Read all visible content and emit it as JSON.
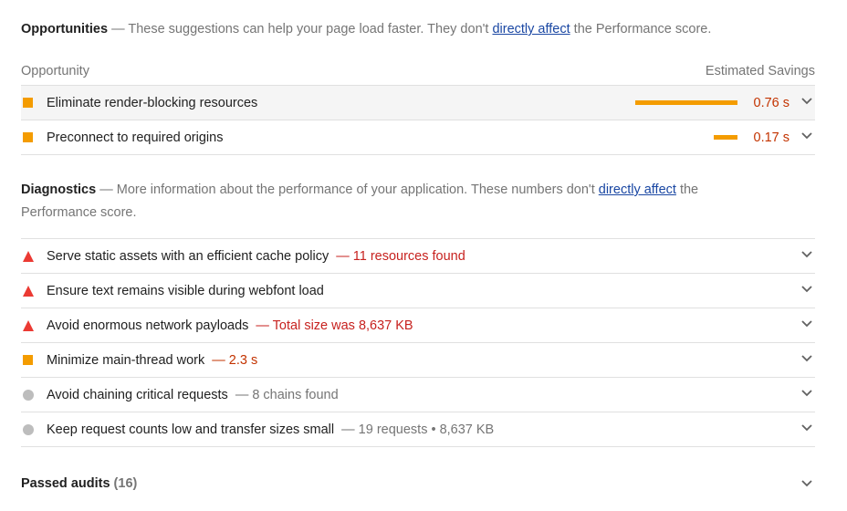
{
  "opportunities": {
    "title": "Opportunities",
    "description_prefix": " — These suggestions can help your page load faster. They don't ",
    "link_text": "directly affect",
    "description_suffix": " the Performance score.",
    "col_opportunity": "Opportunity",
    "col_savings": "Estimated Savings",
    "items": [
      {
        "title": "Eliminate render-blocking resources",
        "savings": "0.76 s",
        "bar_fraction": 1.0
      },
      {
        "title": "Preconnect to required origins",
        "savings": "0.17 s",
        "bar_fraction": 0.23
      }
    ]
  },
  "diagnostics": {
    "title": "Diagnostics",
    "description_prefix": " — More information about the performance of your application. These numbers don't ",
    "link_text": "directly affect",
    "description_suffix": " the Performance score.",
    "items": [
      {
        "title": "Serve static assets with an efficient cache policy",
        "display": "— 11 resources found"
      },
      {
        "title": "Ensure text remains visible during webfont load"
      },
      {
        "title": "Avoid enormous network payloads",
        "display": "— Total size was 8,637 KB"
      },
      {
        "title": "Minimize main-thread work",
        "display": "— 2.3 s"
      },
      {
        "title": "Avoid chaining critical requests",
        "display": "— 8 chains found"
      },
      {
        "title": "Keep request counts low and transfer sizes small",
        "display": "— 19 requests • 8,637 KB"
      }
    ]
  },
  "passed": {
    "title": "Passed audits",
    "count": "(16)"
  },
  "colors": {
    "fail": "#eb3a33",
    "average": "#f49c00",
    "informative": "#bdbdbd",
    "link": "#1a47a3"
  }
}
